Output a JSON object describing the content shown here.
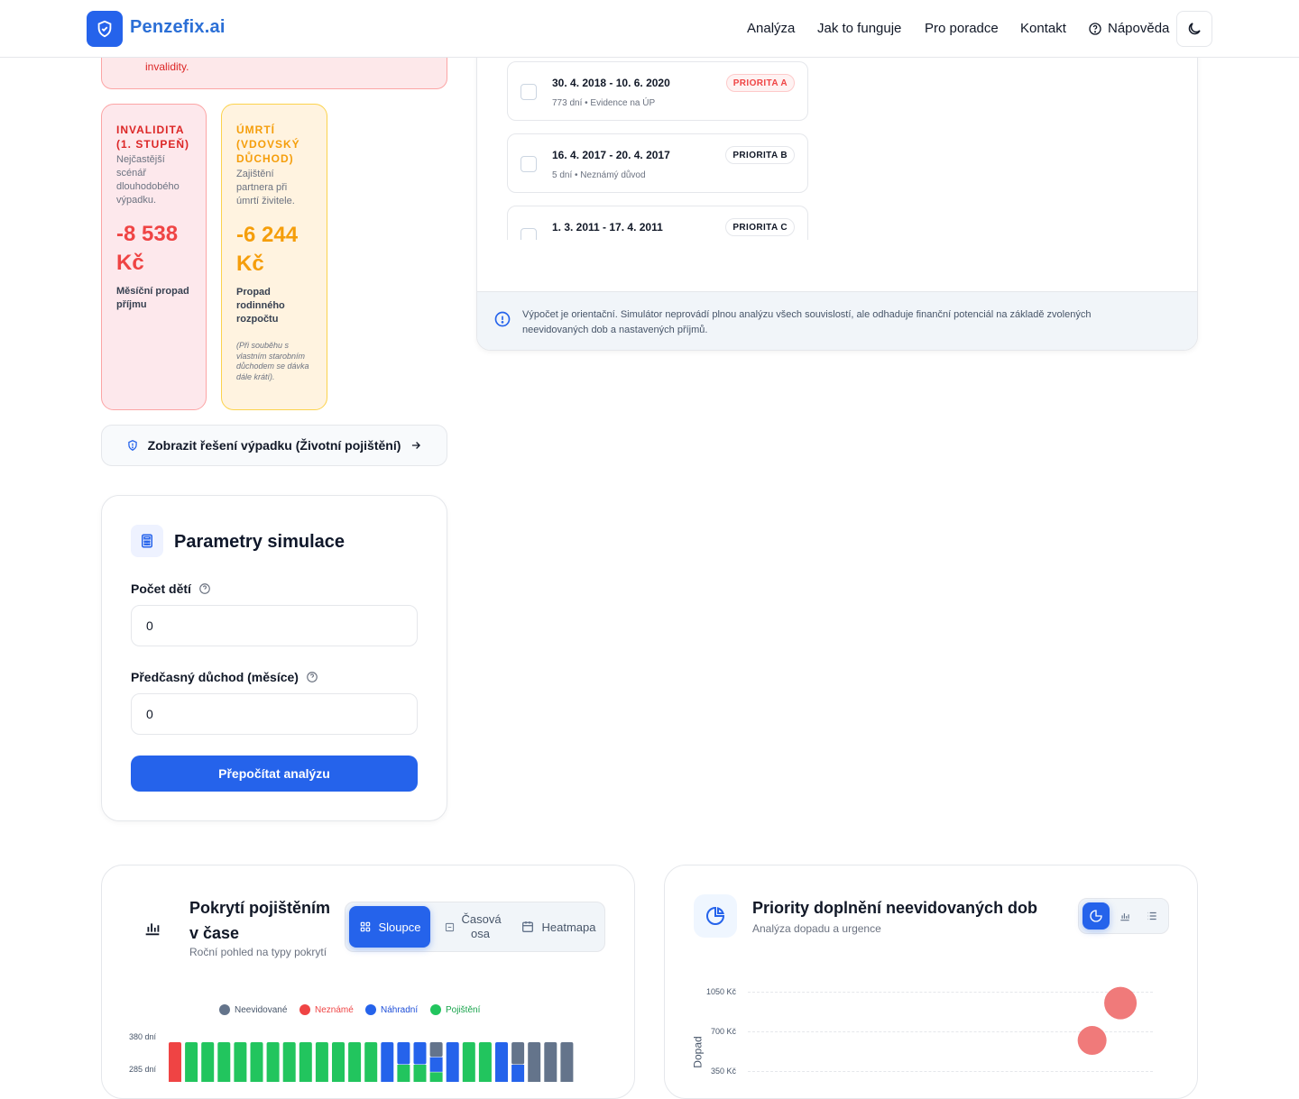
{
  "header": {
    "brand": "Penzefix.ai",
    "nav": [
      "Analýza",
      "Jak to funguje",
      "Pro poradce",
      "Kontakt",
      "Nápověda"
    ]
  },
  "warning": {
    "text": "invalidity."
  },
  "risk_cards": [
    {
      "title": "INVALIDITA (1. STUPEŇ)",
      "desc": "Nejčastější scénář dlouhodobého výpadku.",
      "value": "-8 538 Kč",
      "sub": "Měsíční propad příjmu",
      "note": ""
    },
    {
      "title": "ÚMRTÍ (VDOVSKÝ DŮCHOD)",
      "desc": "Zajištění partnera při úmrtí živitele.",
      "value": "-6 244 Kč",
      "sub": "Propad rodinného rozpočtu",
      "note": "(Při souběhu s vlastním starobním důchodem se dávka dále krátí)."
    }
  ],
  "solution_button": "Zobrazit řešení výpadku (Životní pojištění)",
  "params": {
    "title": "Parametry simulace",
    "children_label": "Počet dětí",
    "children_value": "0",
    "early_label": "Předčasný důchod (měsíce)",
    "early_value": "0",
    "submit": "Přepočítat analýzu"
  },
  "periods": [
    {
      "range": "30. 4. 2018 - 10. 6. 2020",
      "meta": "773 dní • Evidence na ÚP",
      "badge": "PRIORITA A"
    },
    {
      "range": "16. 4. 2017 - 20. 4. 2017",
      "meta": "5 dní • Neznámý důvod",
      "badge": "PRIORITA B"
    },
    {
      "range": "1. 3. 2011 - 17. 4. 2011",
      "meta": "",
      "badge": "PRIORITA C"
    }
  ],
  "info_text": "Výpočet je orientační. Simulátor neprovádí plnou analýzu všech souvislostí, ale odhaduje finanční potenciál na základě zvolených neevidovaných dob a nastavených příjmů.",
  "coverage": {
    "title": "Pokrytí pojištěním v čase",
    "subtitle": "Roční pohled na typy pokrytí",
    "tabs": [
      "Sloupce",
      "Časová osa",
      "Heatmapa"
    ],
    "legend": [
      "Neevidované",
      "Neznámé",
      "Náhradní",
      "Pojištění"
    ],
    "legend_colors": [
      "#64748b",
      "#ef4444",
      "#2563eb",
      "#22c55e"
    ]
  },
  "priorities": {
    "title": "Priority doplnění neevidovaných dob",
    "subtitle": "Analýza dopadu a urgence"
  },
  "chart_data": [
    {
      "type": "bar",
      "title": "Pokrytí pojištěním v čase",
      "ytick_labels": [
        "380 dní",
        "285 dní"
      ],
      "series_names": [
        "Neevidované",
        "Neznámé",
        "Náhradní",
        "Pojištění"
      ],
      "bars": [
        [
          "Neznámé"
        ],
        [
          "Pojištění"
        ],
        [
          "Pojištění"
        ],
        [
          "Pojištění"
        ],
        [
          "Pojištění"
        ],
        [
          "Pojištění"
        ],
        [
          "Pojištění"
        ],
        [
          "Pojištění"
        ],
        [
          "Pojištění"
        ],
        [
          "Pojištění"
        ],
        [
          "Pojištění"
        ],
        [
          "Pojištění"
        ],
        [
          "Pojištění"
        ],
        [
          "Náhradní"
        ],
        [
          "Náhradní",
          "Pojištění"
        ],
        [
          "Náhradní",
          "Pojištění"
        ],
        [
          "Neevidované",
          "Náhradní",
          "Pojištění"
        ],
        [
          "Náhradní"
        ],
        [
          "Pojištění"
        ],
        [
          "Pojištění"
        ],
        [
          "Náhradní"
        ],
        [
          "Neevidované",
          "Náhradní"
        ],
        [
          "Neevidované"
        ],
        [
          "Neevidované"
        ],
        [
          "Neevidované"
        ]
      ]
    },
    {
      "type": "scatter",
      "title": "Priority doplnění neevidovaných dob",
      "ylabel": "Dopad",
      "ytick_labels": [
        "1050 Kč",
        "700 Kč",
        "350 Kč"
      ],
      "yticks": [
        1050,
        700,
        350
      ],
      "points": [
        {
          "x": 0.92,
          "y": 950,
          "size": 18
        },
        {
          "x": 0.85,
          "y": 620,
          "size": 16
        }
      ],
      "color": "#f07a7a"
    }
  ]
}
